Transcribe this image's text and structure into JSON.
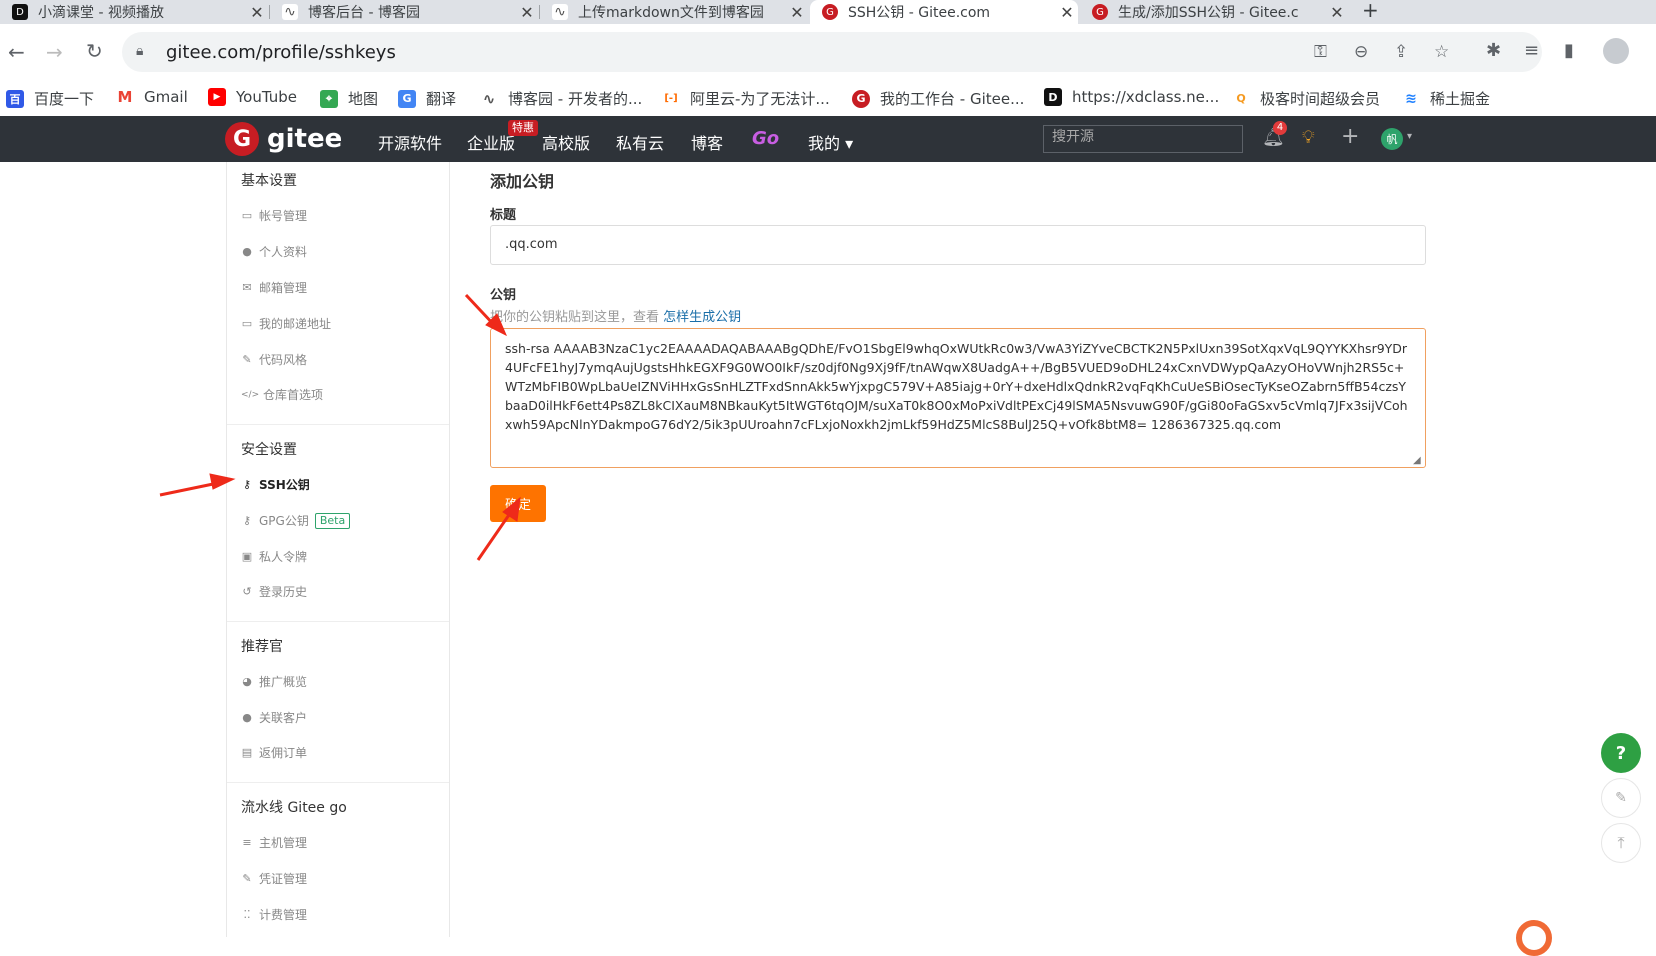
{
  "browser": {
    "tabs": [
      {
        "label": "小滴课堂 - 视频播放",
        "icon": "xd-icon",
        "color": "#111111"
      },
      {
        "label": "博客后台 - 博客园",
        "icon": "cnblogs-icon",
        "color": "#555555"
      },
      {
        "label": "上传markdown文件到博客园",
        "icon": "cnblogs-icon",
        "color": "#555555"
      },
      {
        "label": "SSH公钥 - Gitee.com",
        "icon": "gitee-icon",
        "color": "#c71d23"
      },
      {
        "label": "生成/添加SSH公钥 - Gitee.c",
        "icon": "gitee-icon",
        "color": "#c71d23"
      }
    ],
    "close_glyph": "✕",
    "new_tab": "+",
    "url": "gitee.com/profile/sshkeys",
    "bookmarks": [
      {
        "label": "百度一下",
        "color": "#3059e7",
        "glyph": "百"
      },
      {
        "label": "Gmail",
        "color": "#ea4335",
        "glyph": "M"
      },
      {
        "label": "YouTube",
        "color": "#ff0000",
        "glyph": "▶"
      },
      {
        "label": "地图",
        "color": "#34a853",
        "glyph": "⌖"
      },
      {
        "label": "翻译",
        "color": "#4285f4",
        "glyph": "G"
      },
      {
        "label": "博客园 - 开发者的...",
        "color": "#555555",
        "glyph": "∿"
      },
      {
        "label": "阿里云-为了无法计...",
        "color": "#ff6a00",
        "glyph": "[-]"
      },
      {
        "label": "我的工作台 - Gitee...",
        "color": "#c71d23",
        "glyph": "G"
      },
      {
        "label": "https://xdclass.ne...",
        "color": "#111111",
        "glyph": "D"
      },
      {
        "label": "极客时间超级会员",
        "color": "#f59b23",
        "glyph": "Q"
      },
      {
        "label": "稀土掘金",
        "color": "#1e80ff",
        "glyph": "≋"
      }
    ]
  },
  "gitee": {
    "logo_text": "gitee",
    "nav": [
      "开源软件",
      "企业版",
      "高校版",
      "私有云",
      "博客",
      "Go",
      "我的 ▾"
    ],
    "hot_badge": "特惠",
    "search_placeholder": "搜开源",
    "notification_count": "4",
    "avatar_text": "帆"
  },
  "sidebar": {
    "sections": [
      {
        "title": "基本设置",
        "items": [
          {
            "label": "帐号管理",
            "icon": "▭"
          },
          {
            "label": "个人资料",
            "icon": "●"
          },
          {
            "label": "邮箱管理",
            "icon": "✉"
          },
          {
            "label": "我的邮递地址",
            "icon": "▭"
          },
          {
            "label": "代码风格",
            "icon": "✎"
          },
          {
            "label": "仓库首选项",
            "icon": "</>"
          }
        ]
      },
      {
        "title": "安全设置",
        "items": [
          {
            "label": "SSH公钥",
            "icon": "⚷",
            "active": true
          },
          {
            "label": "GPG公钥",
            "icon": "⚷",
            "badge": "Beta"
          },
          {
            "label": "私人令牌",
            "icon": "▣"
          },
          {
            "label": "登录历史",
            "icon": "↺"
          }
        ]
      },
      {
        "title": "推荐官",
        "items": [
          {
            "label": "推广概览",
            "icon": "◕"
          },
          {
            "label": "关联客户",
            "icon": "●"
          },
          {
            "label": "返佣订单",
            "icon": "▤"
          }
        ]
      },
      {
        "title": "流水线 Gitee go",
        "items": [
          {
            "label": "主机管理",
            "icon": "≡"
          },
          {
            "label": "凭证管理",
            "icon": "✎"
          },
          {
            "label": "计费管理",
            "icon": "⁚⁚"
          }
        ]
      }
    ]
  },
  "form": {
    "heading": "添加公钥",
    "title_label": "标题",
    "title_value": ".qq.com",
    "key_label": "公钥",
    "hint_text": "把你的公钥粘贴到这里，查看",
    "hint_link": "怎样生成公钥",
    "key_value": "ssh-rsa AAAAB3NzaC1yc2EAAAADAQABAAABgQDhE/FvO1SbgEl9whqOxWUtkRc0w3/VwA3YiZYveCBCTK2N5PxlUxn39SotXqxVqL9QYYKXhsr9YDr4UFcFE1hyJ7ymqAujUgstsHhkEGXF9G0WO0IkF/sz0djf0Ng9Xj9fF/tnAWqwX8UadgA++/BgB5VUED9oDHL24xCxnVDWypQaAzyOHoVWnjh2RS5c+WTzMbFIB0WpLbaUeIZNViHHxGsSnHLZTFxdSnnAkk5wYjxpgC579V+A85iajg+0rY+dxeHdlxQdnkR2vqFqKhCuUeSBiOsecTyKseOZabrn5ffB54czsYbaaD0ilHkF6ett4Ps8ZL8kCIXauM8NBkauKyt5ItWGT6tqOJM/suXaT0k8O0xMoPxiVdltPExCj49lSMA5NsvuwG90F/gGi80oFaGSxv5cVmlq7JFx3sijVCohxwh59ApcNlnYDakmpoG76dY2/5ik3pUUroahn7cFLxjoNoxkh2jmLkf59HdZ5MlcS8BulJ25Q+vOfk8btM8= 1286367325.qq.com",
    "submit_label": "确定"
  },
  "floating": {
    "help": "?",
    "note": "✎",
    "top": "⤒"
  },
  "colors": {
    "gitee_red": "#c71d23",
    "header_bg": "#2e3339",
    "primary_orange": "#fe7300",
    "arrow_red": "#ee2a1a",
    "link_blue": "#1a6ea8"
  }
}
